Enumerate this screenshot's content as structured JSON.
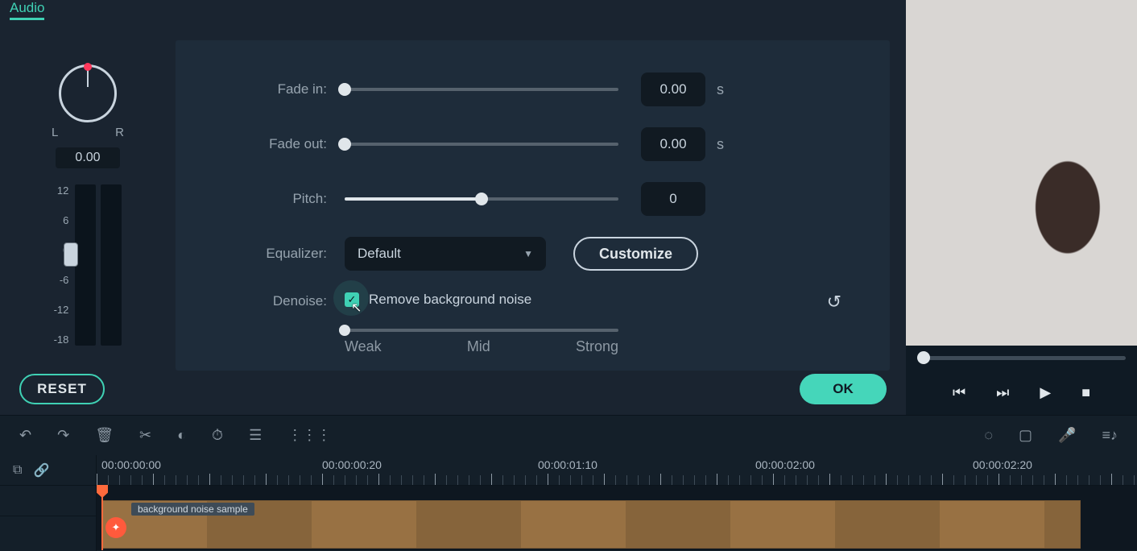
{
  "tab_label": "Audio",
  "pan": {
    "L": "L",
    "R": "R",
    "value": "0.00"
  },
  "db_scale": [
    "12",
    "6",
    "0",
    "-6",
    "-12",
    "-18"
  ],
  "controls": {
    "fade_in": {
      "label": "Fade in:",
      "value": "0.00",
      "unit": "s",
      "pct": 0
    },
    "fade_out": {
      "label": "Fade out:",
      "value": "0.00",
      "unit": "s",
      "pct": 0
    },
    "pitch": {
      "label": "Pitch:",
      "value": "0",
      "pct": 50
    },
    "equalizer": {
      "label": "Equalizer:",
      "selected": "Default",
      "customize": "Customize"
    },
    "denoise": {
      "label": "Denoise:",
      "checkbox_label": "Remove background noise",
      "levels": {
        "weak": "Weak",
        "mid": "Mid",
        "strong": "Strong"
      }
    }
  },
  "footer": {
    "reset": "RESET",
    "ok": "OK"
  },
  "timeline": {
    "timecodes": [
      "00:00:00:00",
      "00:00:00:20",
      "00:00:01:10",
      "00:00:02:00",
      "00:00:02:20"
    ],
    "clip_label": "background noise sample"
  }
}
